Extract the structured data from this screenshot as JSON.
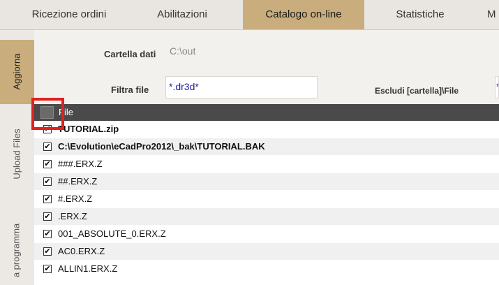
{
  "tabs": [
    {
      "label": "Ricezione ordini"
    },
    {
      "label": "Abilitazioni"
    },
    {
      "label": "Catalogo on-line"
    },
    {
      "label": "Statistiche"
    },
    {
      "label": "M"
    }
  ],
  "active_tab": "Catalogo on-line",
  "side_tabs": [
    {
      "label": "Aggiorna"
    },
    {
      "label": "Upload Files"
    },
    {
      "label": "a programma"
    }
  ],
  "form": {
    "data_folder_label": "Cartella dati",
    "data_folder_value": "C:\\out",
    "filter_label": "Filtra file",
    "filter_value": "*.dr3d*",
    "exclude_label": "Escludi [cartella]\\File",
    "exclude_value": "*"
  },
  "grid": {
    "header": "File",
    "rows": [
      {
        "name": "TUTORIAL.zip",
        "checked": true,
        "bold": true
      },
      {
        "name": "C:\\Evolution\\eCadPro2012\\_bak\\TUTORIAL.BAK",
        "checked": true,
        "bold": true
      },
      {
        "name": "###.ERX.Z",
        "checked": true,
        "bold": false
      },
      {
        "name": "##.ERX.Z",
        "checked": true,
        "bold": false
      },
      {
        "name": "#.ERX.Z",
        "checked": true,
        "bold": false
      },
      {
        "name": ".ERX.Z",
        "checked": true,
        "bold": false
      },
      {
        "name": "001_ABSOLUTE_0.ERX.Z",
        "checked": true,
        "bold": false
      },
      {
        "name": "AC0.ERX.Z",
        "checked": true,
        "bold": false
      },
      {
        "name": "ALLIN1.ERX.Z",
        "checked": true,
        "bold": false
      }
    ]
  },
  "check_glyph": "✔",
  "colors": {
    "accent": "#c9ad7c",
    "header": "#4a4a4a",
    "highlight": "#e22020",
    "input_text": "#2020a0"
  }
}
